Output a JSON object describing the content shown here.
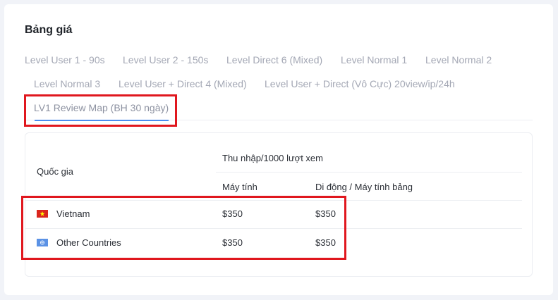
{
  "card": {
    "title": "Bảng giá"
  },
  "tabs": [
    {
      "label": "Level User 1 - 90s",
      "active": false
    },
    {
      "label": "Level User 2 - 150s",
      "active": false
    },
    {
      "label": "Level Direct 6 (Mixed)",
      "active": false
    },
    {
      "label": "Level Normal 1",
      "active": false
    },
    {
      "label": "Level Normal 2",
      "active": false
    },
    {
      "label": "Level Normal 3",
      "active": false
    },
    {
      "label": "Level User + Direct 4 (Mixed)",
      "active": false
    },
    {
      "label": "Level User + Direct (Vô Cực) 20view/ip/24h",
      "active": false
    },
    {
      "label": "LV1 Review Map (BH 30 ngày)",
      "active": true
    }
  ],
  "table": {
    "col_country": "Quốc gia",
    "col_income": "Thu nhập/1000 lượt xem",
    "col_desktop": "Máy tính",
    "col_mobile": "Di động / Máy tính bảng",
    "rows": [
      {
        "flag": "vietnam-flag-icon",
        "country": "Vietnam",
        "desktop": "$350",
        "mobile": "$350"
      },
      {
        "flag": "un-flag-icon",
        "country": "Other Countries",
        "desktop": "$350",
        "mobile": "$350"
      }
    ]
  },
  "colors": {
    "accent": "#4a8df0",
    "highlight": "#e0171e",
    "vietnam_red": "#da251d",
    "vietnam_star": "#ffff00",
    "un_blue": "#5b92e5"
  }
}
